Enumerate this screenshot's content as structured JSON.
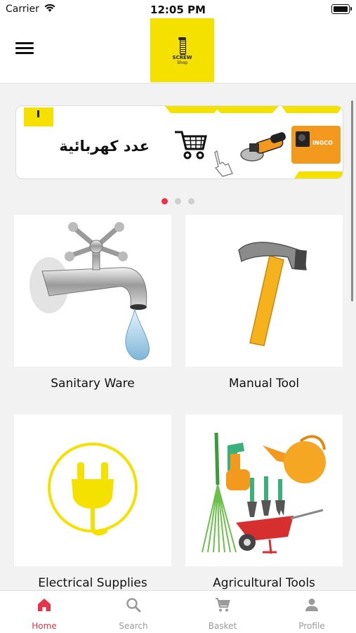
{
  "status_bar": {
    "carrier": "Carrier",
    "time": "12:05 PM"
  },
  "header": {
    "logo": {
      "line1": "SCREW",
      "line2": "Shop"
    }
  },
  "banner": {
    "headline": "عدد كهربائية",
    "brand": "INGCO",
    "logo_text": "SCREW Shop"
  },
  "carousel": {
    "page_count": 3,
    "active_index": 0
  },
  "categories": [
    {
      "label": "Sanitary Ware",
      "icon": "faucet-icon"
    },
    {
      "label": "Manual Tool",
      "icon": "hammer-icon"
    },
    {
      "label": "Electrical Supplies",
      "icon": "plug-icon"
    },
    {
      "label": "Agricultural Tools",
      "icon": "garden-tools-icon"
    }
  ],
  "tabs": [
    {
      "label": "Home",
      "icon": "home-icon",
      "active": true
    },
    {
      "label": "Search",
      "icon": "search-icon",
      "active": false
    },
    {
      "label": "Basket",
      "icon": "cart-icon",
      "active": false
    },
    {
      "label": "Profile",
      "icon": "person-icon",
      "active": false
    }
  ],
  "colors": {
    "accent": "#e8334a",
    "brand_yellow": "#f5e100",
    "inactive": "#9b9b9b"
  }
}
